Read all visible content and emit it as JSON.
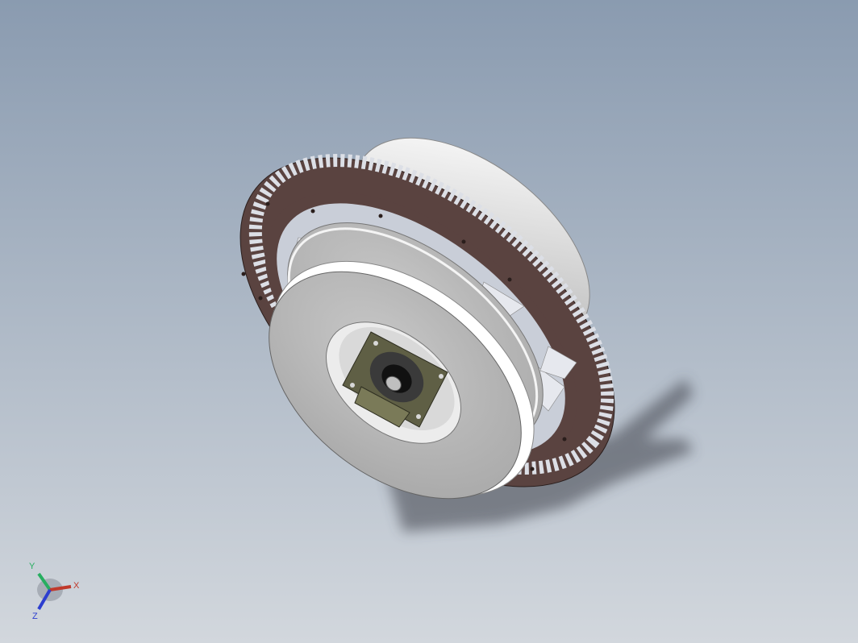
{
  "viewport": {
    "background_top": "#8a9bb0",
    "background_bottom": "#d2d7dd"
  },
  "model": {
    "ring_color": "#5a4340",
    "tooth_color": "#dcdfe6",
    "disk_color": "#b9b9b9",
    "bracket_color": "#5f5f45"
  },
  "triad": {
    "x_label": "X",
    "y_label": "Y",
    "z_label": "Z",
    "x_color": "#c0392b",
    "y_color": "#27ae60",
    "z_color": "#2c3ecf"
  }
}
